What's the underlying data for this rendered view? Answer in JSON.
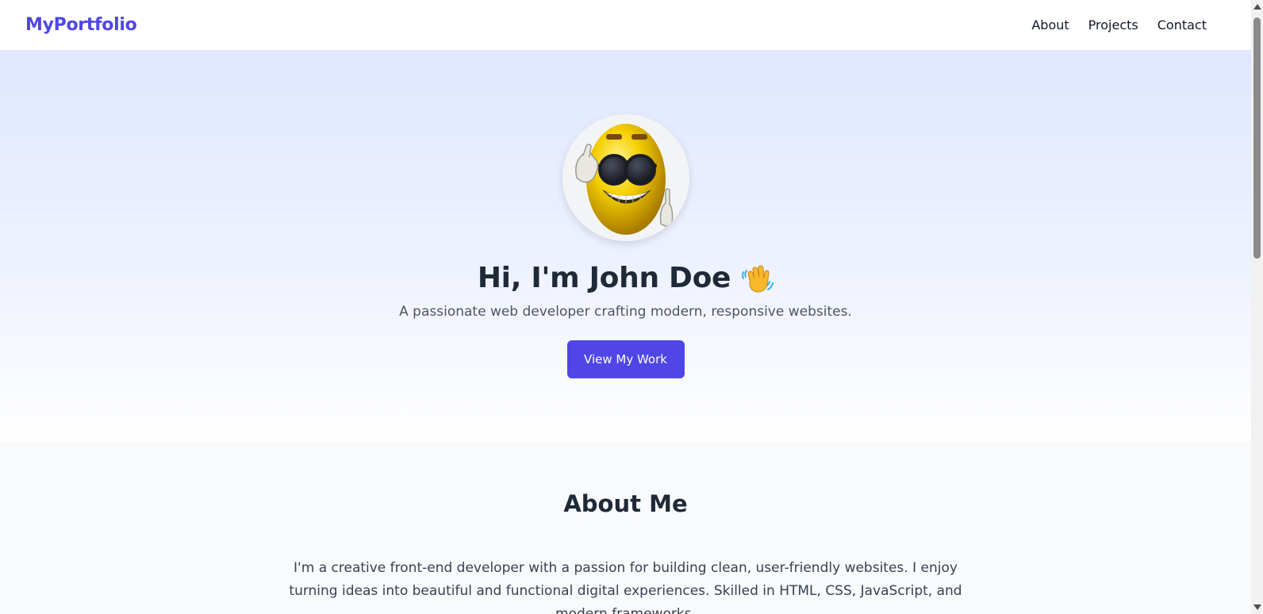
{
  "nav": {
    "brand": "MyPortfolio",
    "links": [
      "About",
      "Projects",
      "Contact"
    ]
  },
  "hero": {
    "title": "Hi, I'm John Doe",
    "subtitle": "A passionate web developer crafting modern, responsive websites.",
    "cta_label": "View My Work"
  },
  "about": {
    "heading": "About Me",
    "body": "I'm a creative front-end developer with a passion for building clean, user-friendly websites. I enjoy turning ideas into beautiful and functional digital experiences. Skilled in HTML, CSS, JavaScript, and modern frameworks."
  },
  "icons": {
    "avatar": "sunglasses-emoji-avatar",
    "wave": "waving-hand-icon"
  },
  "colors": {
    "brand": "#4f46e5",
    "heading": "#1f2937",
    "text": "#4b5563",
    "hero_gradient_top": "#e0e7ff",
    "page_background": "#f8fafc"
  }
}
